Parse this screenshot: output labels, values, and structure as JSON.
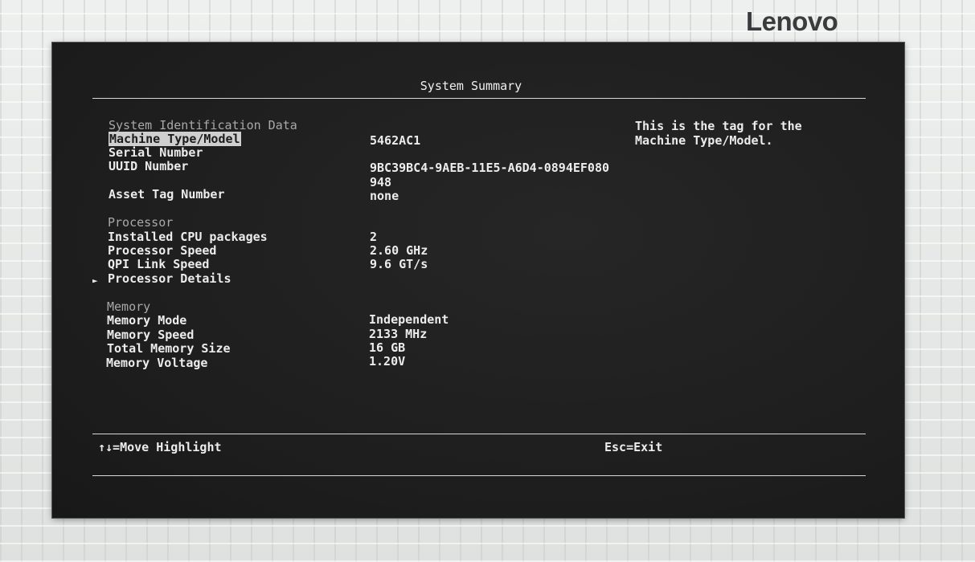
{
  "brand": {
    "logo_text": "Lenovo"
  },
  "screen": {
    "title": "System Summary",
    "sections": {
      "system": {
        "header": "System Identification Data",
        "machine_type_label": "Machine Type/Model",
        "machine_type_value": "5462AC1",
        "serial_label": "Serial Number",
        "uuid_label": "UUID Number",
        "uuid_value_line1": "9BC39BC4-9AEB-11E5-A6D4-0894EF080",
        "uuid_value_line2": "948",
        "asset_tag_label": "Asset Tag Number",
        "asset_tag_value": "none"
      },
      "processor": {
        "header": "Processor",
        "cpu_packages_label": "Installed CPU packages",
        "cpu_packages_value": "2",
        "speed_label": "Processor Speed",
        "speed_value": "2.60 GHz",
        "qpi_label": "QPI Link Speed",
        "qpi_value": "9.6 GT/s",
        "details_marker": "►",
        "details_label": "Processor Details"
      },
      "memory": {
        "header": "Memory",
        "mode_label": "Memory Mode",
        "mode_value": "Independent",
        "speed_label": "Memory Speed",
        "speed_value": "2133 MHz",
        "total_label": "Total Memory Size",
        "total_value": "16 GB",
        "voltage_label": "Memory Voltage",
        "voltage_value": "1.20V"
      }
    },
    "help_text_line1": "This is the tag for the",
    "help_text_line2": "Machine Type/Model.",
    "footer": {
      "move_hint": "↑↓=Move Highlight",
      "exit_hint": "Esc=Exit"
    }
  }
}
